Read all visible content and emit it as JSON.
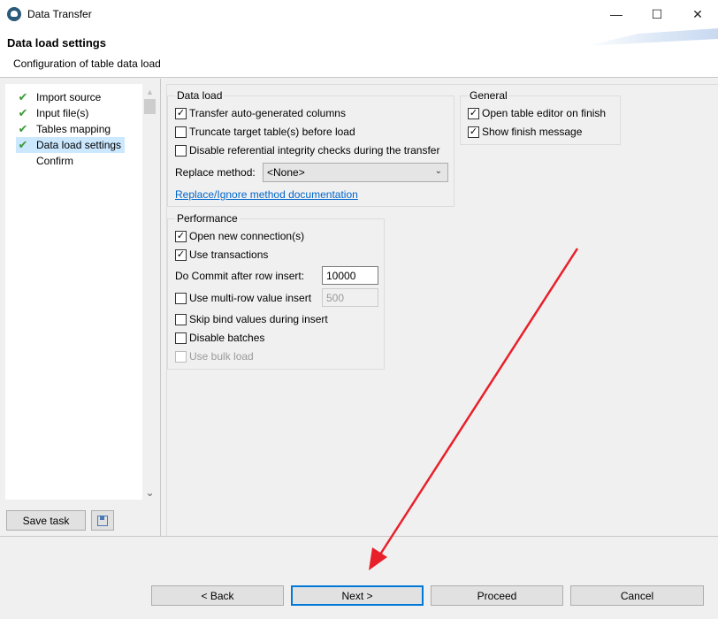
{
  "window": {
    "title": "Data Transfer",
    "minimize": "—",
    "maximize": "☐",
    "close": "✕"
  },
  "banner": {
    "title": "Data load settings",
    "description": "Configuration of table data load"
  },
  "sidebar": {
    "items": [
      {
        "label": "Import source",
        "done": true
      },
      {
        "label": "Input file(s)",
        "done": true
      },
      {
        "label": "Tables mapping",
        "done": true
      },
      {
        "label": "Data load settings",
        "done": true,
        "selected": true
      },
      {
        "label": "Confirm",
        "done": false
      }
    ],
    "check_glyph": "✔",
    "scroll_up": "▲",
    "scroll_down": "⌄",
    "save_task_label": "Save task"
  },
  "data_load": {
    "title": "Data load",
    "transfer_auto_generated": {
      "label": "Transfer auto-generated columns",
      "checked": true
    },
    "truncate_target": {
      "label": "Truncate target table(s) before load",
      "checked": false
    },
    "disable_referential": {
      "label": "Disable referential integrity checks during the transfer",
      "checked": false
    },
    "replace_method_label": "Replace method:",
    "replace_method_value": "<None>",
    "replace_doc_link": "Replace/Ignore method documentation"
  },
  "general": {
    "title": "General",
    "open_table_editor": {
      "label": "Open table editor on finish",
      "checked": true
    },
    "show_finish_message": {
      "label": "Show finish message",
      "checked": true
    }
  },
  "performance": {
    "title": "Performance",
    "open_new_connection": {
      "label": "Open new connection(s)",
      "checked": true
    },
    "use_transactions": {
      "label": "Use transactions",
      "checked": true
    },
    "commit_label": "Do Commit after row insert:",
    "commit_value": "10000",
    "multi_row": {
      "label": "Use multi-row value insert",
      "checked": false,
      "value": "500"
    },
    "skip_bind": {
      "label": "Skip bind values during insert",
      "checked": false
    },
    "disable_batches": {
      "label": "Disable batches",
      "checked": false
    },
    "use_bulk_load": {
      "label": "Use bulk load",
      "checked": false,
      "disabled": true
    }
  },
  "footer": {
    "back": "< Back",
    "next": "Next >",
    "proceed": "Proceed",
    "cancel": "Cancel"
  },
  "checkmark": "✓",
  "colors": {
    "accent": "#0078d7",
    "link": "#0066cc",
    "annotation_arrow": "#e8202a",
    "check_green": "#3a9a3a"
  }
}
